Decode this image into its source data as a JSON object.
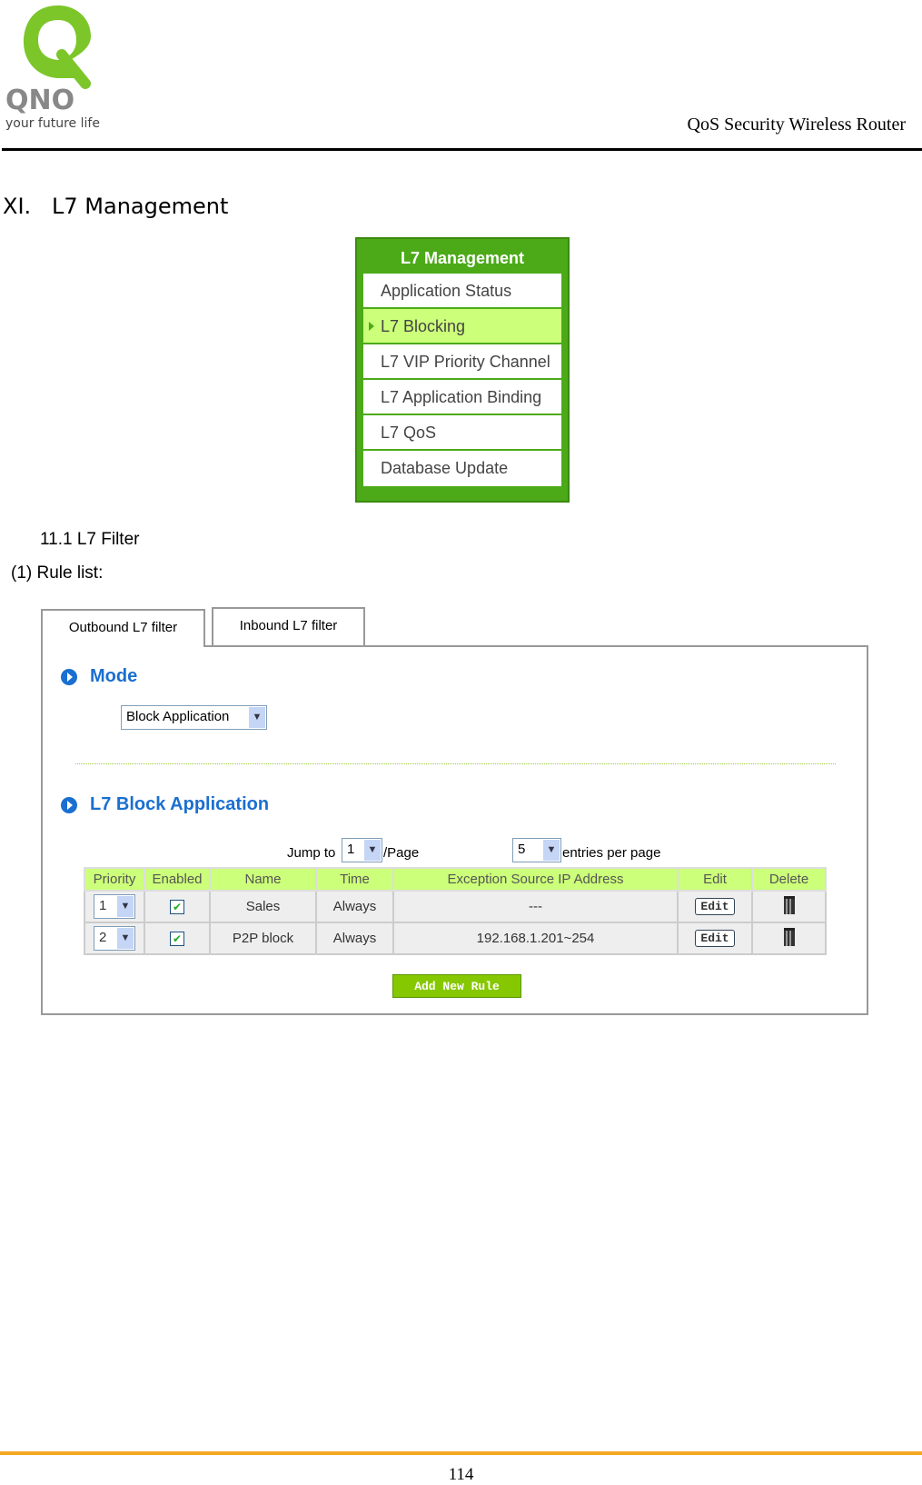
{
  "header": {
    "logo_text": "QNO",
    "logo_tagline": "your future life",
    "product": "QoS Security Wireless Router"
  },
  "section_title": "XI.   L7 Management",
  "menu": {
    "title": "L7 Management",
    "items": [
      {
        "label": "Application Status",
        "active": false
      },
      {
        "label": "L7 Blocking",
        "active": true
      },
      {
        "label": "L7 VIP Priority Channel",
        "active": false
      },
      {
        "label": "L7 Application Binding",
        "active": false
      },
      {
        "label": "L7 QoS",
        "active": false
      },
      {
        "label": "Database Update",
        "active": false
      }
    ]
  },
  "subsection": "11.1 L7 Filter",
  "subsubsection": "(1) Rule list:",
  "tabs": [
    {
      "label": "Outbound L7 filter",
      "active": true
    },
    {
      "label": "Inbound L7 filter",
      "active": false
    }
  ],
  "mode": {
    "title": "Mode",
    "value": "Block Application"
  },
  "block": {
    "title": "L7 Block Application",
    "jump_label": "Jump to",
    "page": "1",
    "page_suffix": "/Page",
    "entries": "5",
    "entries_label": "entries per page",
    "columns": [
      "Priority",
      "Enabled",
      "Name",
      "Time",
      "Exception Source IP Address",
      "Edit",
      "Delete"
    ],
    "rows": [
      {
        "priority": "1",
        "enabled": true,
        "name": "Sales",
        "time": "Always",
        "ip": "---",
        "edit": "Edit"
      },
      {
        "priority": "2",
        "enabled": true,
        "name": "P2P block",
        "time": "Always",
        "ip": "192.168.1.201~254",
        "edit": "Edit"
      }
    ],
    "add_label": "Add New Rule"
  },
  "page_number": "114",
  "colors": {
    "menu_green": "#4caa19",
    "header_green": "#ccff7a",
    "accent_blue": "#1a6fd0",
    "footer_orange": "#f5a623"
  }
}
